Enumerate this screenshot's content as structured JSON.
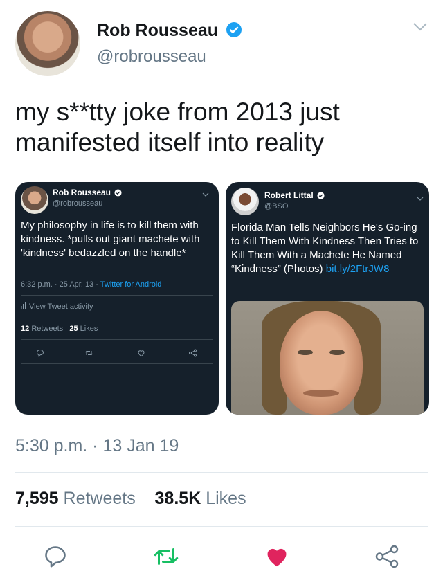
{
  "tweet": {
    "name": "Rob Rousseau",
    "handle": "@robrousseau",
    "text": "my s**tty joke from 2013 just manifested itself into reality",
    "timestamp": "5:30 p.m. · 13 Jan 19",
    "retweets_count": "7,595",
    "retweets_label": "Retweets",
    "likes_count": "38.5K",
    "likes_label": "Likes"
  },
  "left_embed": {
    "name": "Rob Rousseau",
    "handle": "@robrousseau",
    "text": "My philosophy in life is to kill them with kindness. *pulls out giant machete with 'kindness' bedazzled on the handle*",
    "time": "6:32 p.m. · 25 Apr. 13 · ",
    "client": "Twitter for Android",
    "activity": "View Tweet activity",
    "retweets_count": "12",
    "retweets_label": "Retweets",
    "likes_count": "25",
    "likes_label": "Likes"
  },
  "right_embed": {
    "name": "Robert Littal",
    "handle": "@BSO",
    "text": "Florida Man Tells Neighbors He's Go-ing to Kill Them With Kindness Then Tries to Kill Them With a Machete He Named “Kindness” (Photos) ",
    "link": "bit.ly/2FtrJW8"
  },
  "colors": {
    "accent": "#1da1f2",
    "like_red": "#e0245e",
    "retweet_green": "#17bf63",
    "panel_bg": "#15202b"
  },
  "icons": [
    "verified-badge-icon",
    "chevron-down-icon",
    "reply-icon",
    "retweet-icon",
    "like-icon",
    "share-icon",
    "activity-icon"
  ]
}
